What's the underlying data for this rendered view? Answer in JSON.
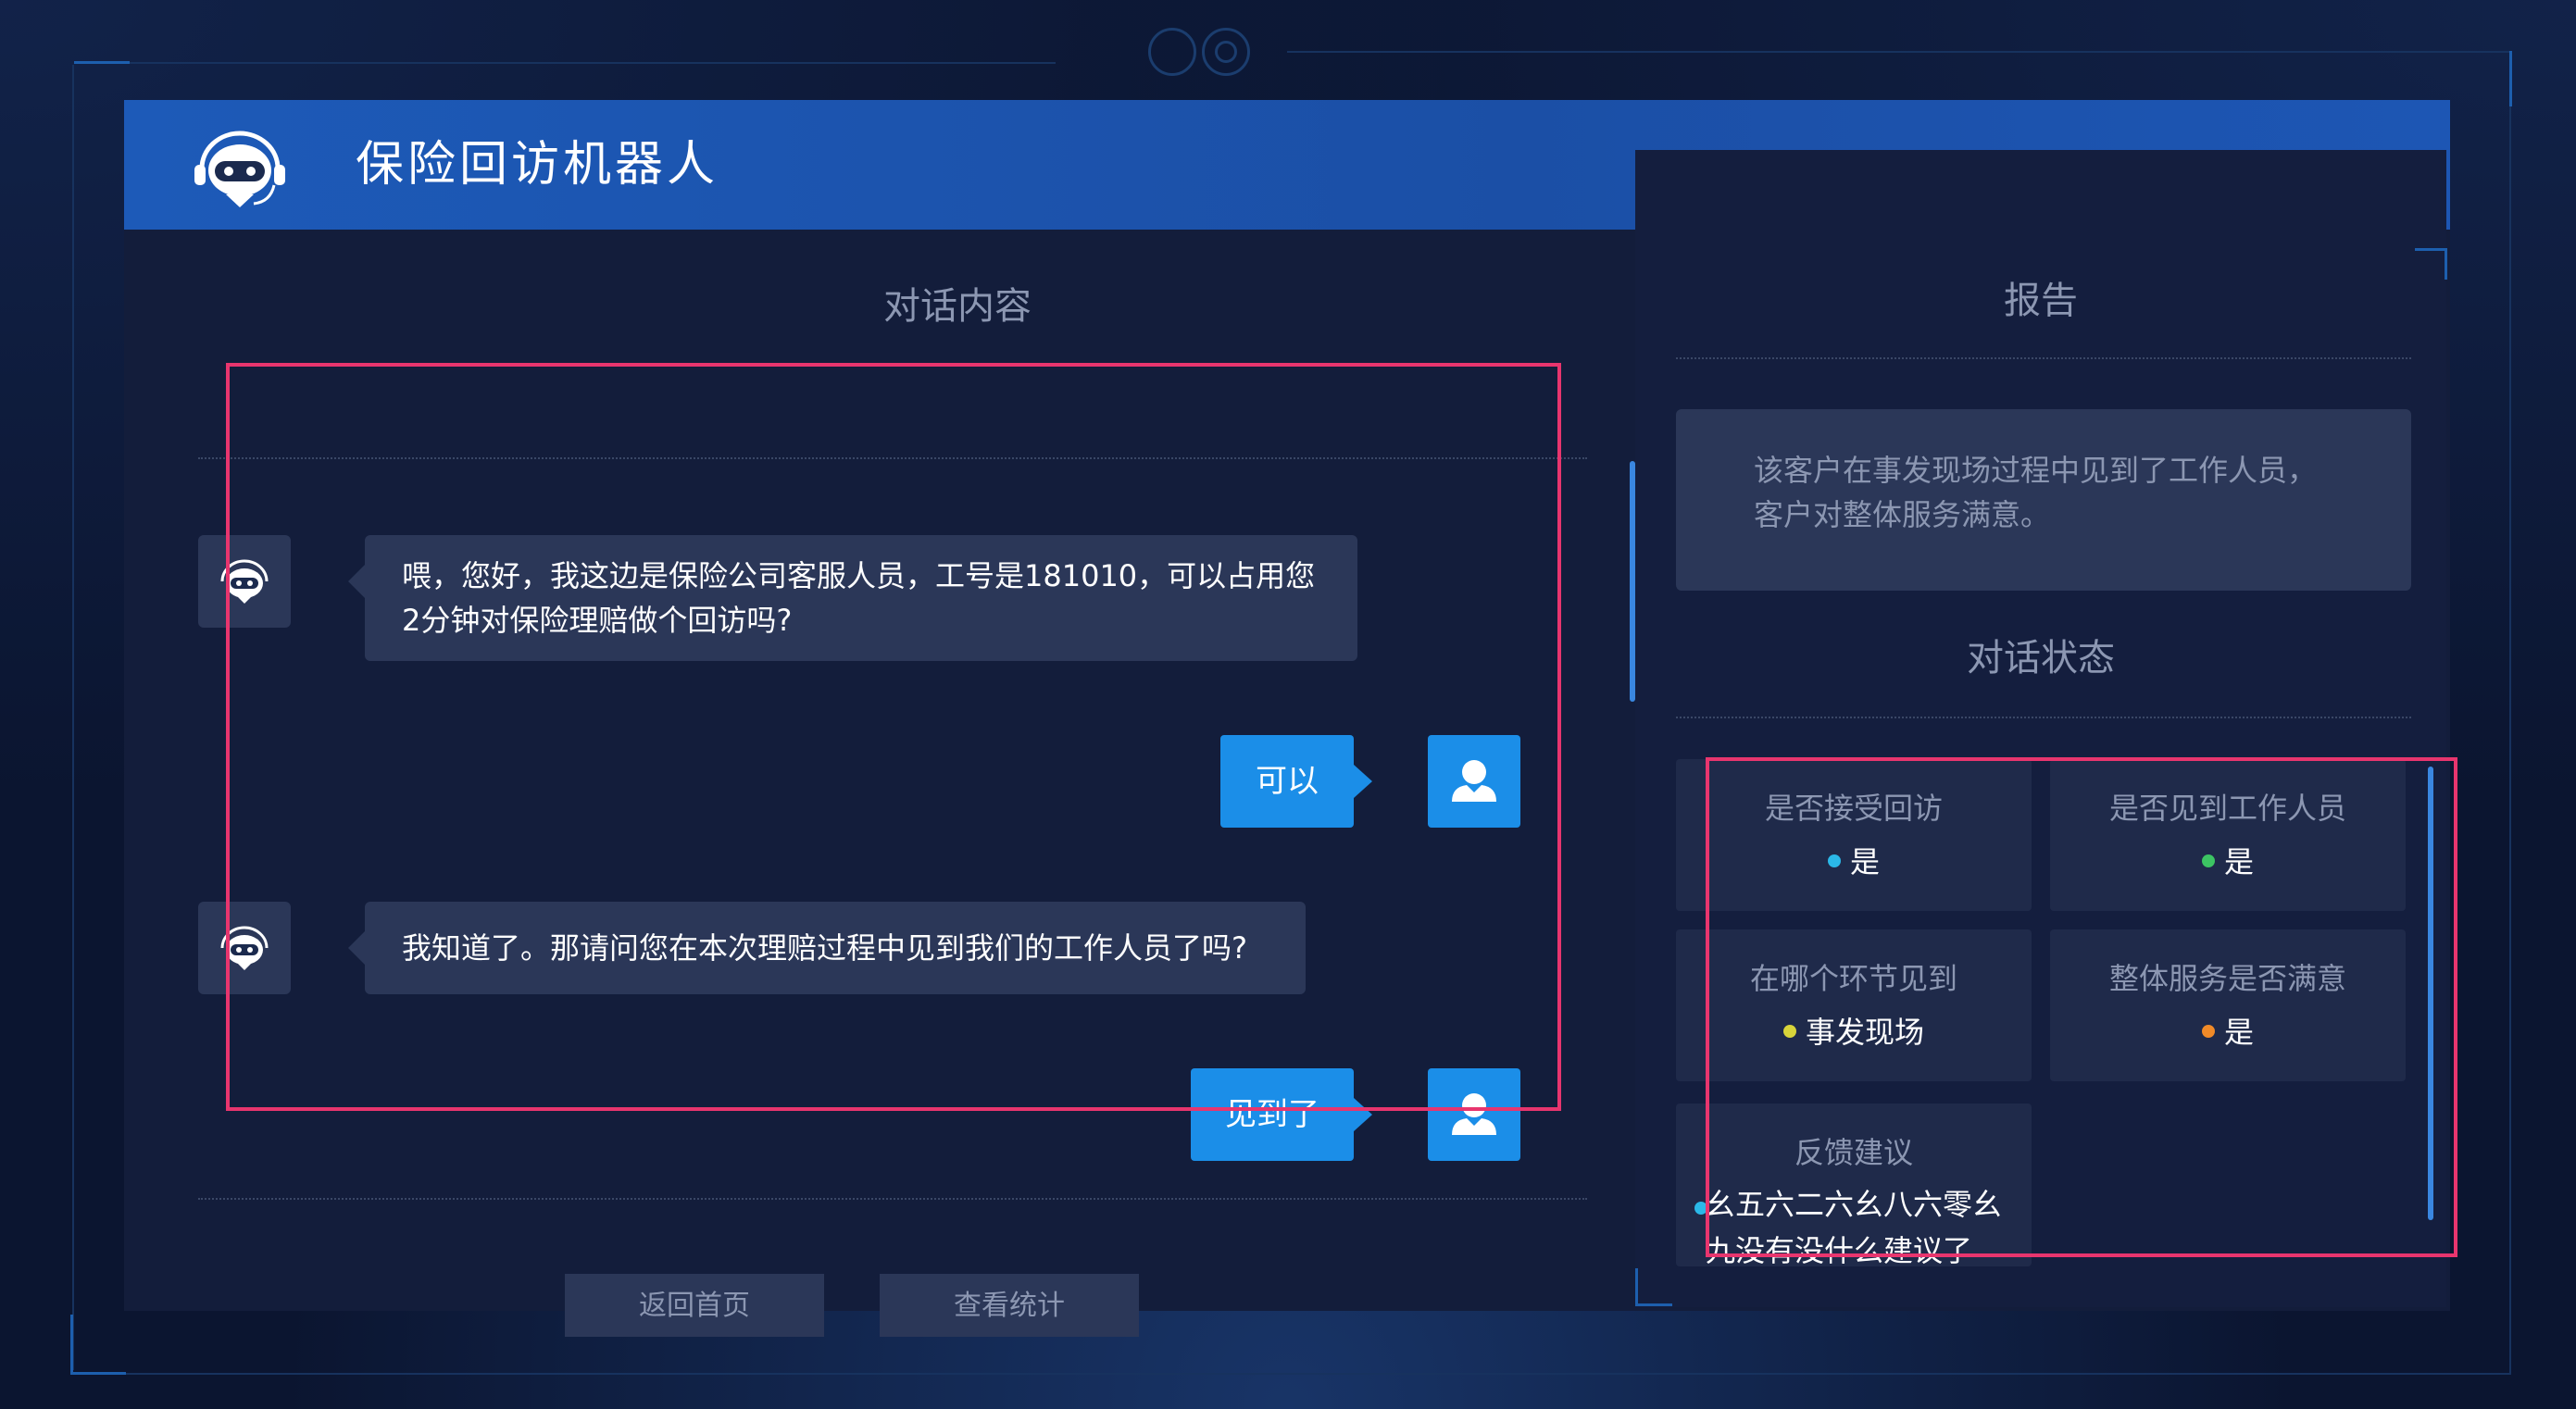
{
  "app": {
    "title": "保险回访机器人",
    "brand_color": "#1d5ab8",
    "highlight_color": "#e8356e"
  },
  "conversation": {
    "title": "对话内容",
    "messages": [
      {
        "role": "bot",
        "text": "喂，您好，我这边是保险公司客服人员，工号是181010，可以占用您2分钟对保险理赔做个回访吗?"
      },
      {
        "role": "user",
        "text": "可以"
      },
      {
        "role": "bot",
        "text": "我知道了。那请问您在本次理赔过程中见到我们的工作人员了吗?"
      },
      {
        "role": "user",
        "text": "见到了"
      }
    ],
    "buttons": {
      "home": "返回首页",
      "stats": "查看统计"
    }
  },
  "report": {
    "title": "报告",
    "summary": "该客户在事发现场过程中见到了工作人员，客户对整体服务满意。",
    "status_title": "对话状态",
    "cards": [
      {
        "label": "是否接受回访",
        "value": "是",
        "dot_color": "#2bb8e8"
      },
      {
        "label": "是否见到工作人员",
        "value": "是",
        "dot_color": "#3cc463"
      },
      {
        "label": "在哪个环节见到",
        "value": "事发现场",
        "dot_color": "#d8d43a"
      },
      {
        "label": "整体服务是否满意",
        "value": "是",
        "dot_color": "#f08a28"
      },
      {
        "label": "反馈建议",
        "value": "幺五六二六幺八六零幺九没有没什么建议了",
        "dot_color": "#2bb8e8"
      }
    ]
  },
  "icons": {
    "logo": "robot-logo-icon",
    "bot_avatar": "robot-avatar-icon",
    "user_avatar": "user-avatar-icon"
  }
}
